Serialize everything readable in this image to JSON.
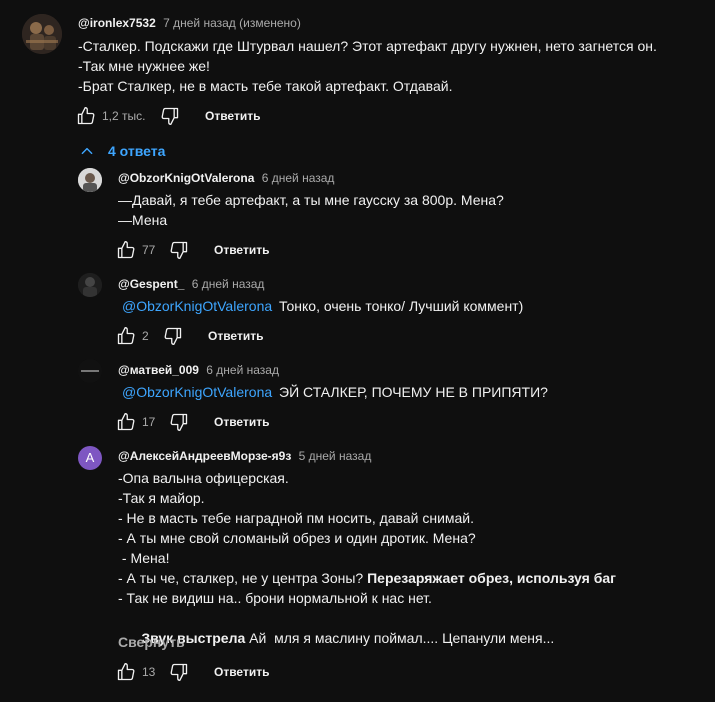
{
  "main_comment": {
    "author": "@ironlex7532",
    "time": "7 дней назад (изменено)",
    "lines": [
      "-Сталкер. Подскажи где Штурвал нашел? Этот артефакт другу нужнен, нето загнется он.",
      "-Так мне нужнее же!",
      "-Брат Сталкер, не в масть тебе такой артефакт. Отдавай."
    ],
    "likes": "1,2 тыс.",
    "reply_label": "Ответить"
  },
  "replies_toggle": {
    "label": "4 ответа",
    "icon": "chevron-up-icon"
  },
  "replies": [
    {
      "author": "@ObzorKnigOtValerona",
      "time": "6 дней назад",
      "line1": "—Давай, я тебе артефакт, а ты мне гаусску за 800р. Мена?",
      "line2": "—Мена",
      "likes": "77",
      "reply_label": "Ответить"
    },
    {
      "author": "@Gespent_",
      "time": "6 дней назад",
      "mention": "@ObzorKnigOtValerona",
      "text": "Тонко, очень тонко/ Лучший коммент)",
      "likes": "2",
      "reply_label": "Ответить"
    },
    {
      "author": "@матвей_009",
      "time": "6 дней назад",
      "mention": "@ObzorKnigOtValerona",
      "text": "ЭЙ СТАЛКЕР, ПОЧЕМУ НЕ В ПРИПЯТИ?",
      "likes": "17",
      "reply_label": "Ответить"
    },
    {
      "author": "@АлексейАндреевМорзе-я9з",
      "time": "5 дней назад",
      "avatar_letter": "А",
      "lines": [
        "-Опа валына офицерская.",
        "-Так я майор.",
        "- Не в масть тебе наградной пм носить, давай снимай.",
        "- А ты мне свой сломаный обрез и один дротик. Мена?",
        " - Мена!"
      ],
      "line6_plain": "- А ты че, сталкер, не у центра Зоны? ",
      "line6_bold": "Перезаряжает обрез, используя баг",
      "line7": "- Так не видиш на.. брони нормальной к нас нет.",
      "line8_bold": "Звук выстрела",
      "line8_plain": " Ай  мля я маслину поймал.... Цепанули меня...",
      "collapse_label": "Свернуть",
      "likes": "13",
      "reply_label": "Ответить"
    }
  ],
  "colors": {
    "background": "#0f0f0f",
    "text": "#f1f1f1",
    "secondary": "#aaaaaa",
    "link": "#3ea6ff",
    "avatar_purple": "#7e57c2"
  }
}
